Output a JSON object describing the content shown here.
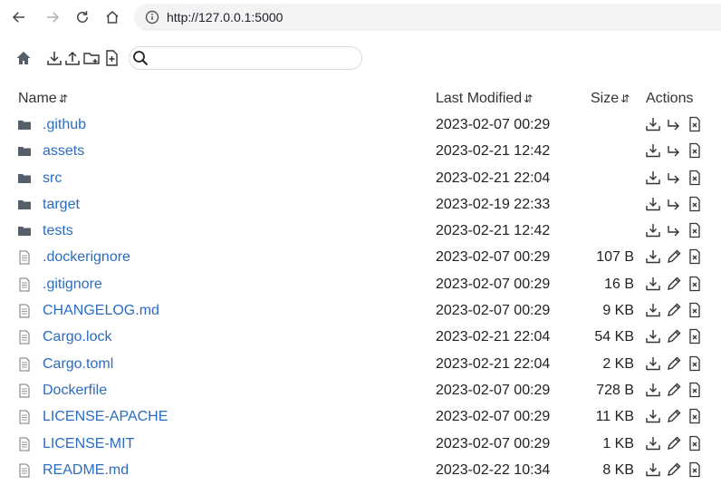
{
  "browser": {
    "url": "http://127.0.0.1:5000"
  },
  "toolbar": {
    "search_value": "",
    "search_placeholder": ""
  },
  "table": {
    "headers": {
      "name": "Name",
      "modified": "Last Modified",
      "size": "Size",
      "actions": "Actions"
    },
    "sort_glyph": "⇵",
    "rows": [
      {
        "name": ".github",
        "type": "folder",
        "modified": "2023-02-07 00:29",
        "size": ""
      },
      {
        "name": "assets",
        "type": "folder",
        "modified": "2023-02-21 12:42",
        "size": ""
      },
      {
        "name": "src",
        "type": "folder",
        "modified": "2023-02-21 22:04",
        "size": ""
      },
      {
        "name": "target",
        "type": "folder",
        "modified": "2023-02-19 22:33",
        "size": ""
      },
      {
        "name": "tests",
        "type": "folder",
        "modified": "2023-02-21 12:42",
        "size": ""
      },
      {
        "name": ".dockerignore",
        "type": "file",
        "modified": "2023-02-07 00:29",
        "size": "107 B"
      },
      {
        "name": ".gitignore",
        "type": "file",
        "modified": "2023-02-07 00:29",
        "size": "16 B"
      },
      {
        "name": "CHANGELOG.md",
        "type": "file",
        "modified": "2023-02-07 00:29",
        "size": "9 KB"
      },
      {
        "name": "Cargo.lock",
        "type": "file",
        "modified": "2023-02-21 22:04",
        "size": "54 KB"
      },
      {
        "name": "Cargo.toml",
        "type": "file",
        "modified": "2023-02-21 22:04",
        "size": "2 KB"
      },
      {
        "name": "Dockerfile",
        "type": "file",
        "modified": "2023-02-07 00:29",
        "size": "728 B"
      },
      {
        "name": "LICENSE-APACHE",
        "type": "file",
        "modified": "2023-02-07 00:29",
        "size": "11 KB"
      },
      {
        "name": "LICENSE-MIT",
        "type": "file",
        "modified": "2023-02-07 00:29",
        "size": "1 KB"
      },
      {
        "name": "README.md",
        "type": "file",
        "modified": "2023-02-22 10:34",
        "size": "8 KB"
      }
    ]
  },
  "colors": {
    "link": "#2b6cc0",
    "folder_icon": "#555e6b",
    "icon_stroke": "#333333"
  },
  "icons": {
    "folder": "folder-icon",
    "file": "file-icon",
    "download": "download-icon",
    "move": "move-icon",
    "edit": "edit-icon",
    "delete": "delete-icon"
  }
}
